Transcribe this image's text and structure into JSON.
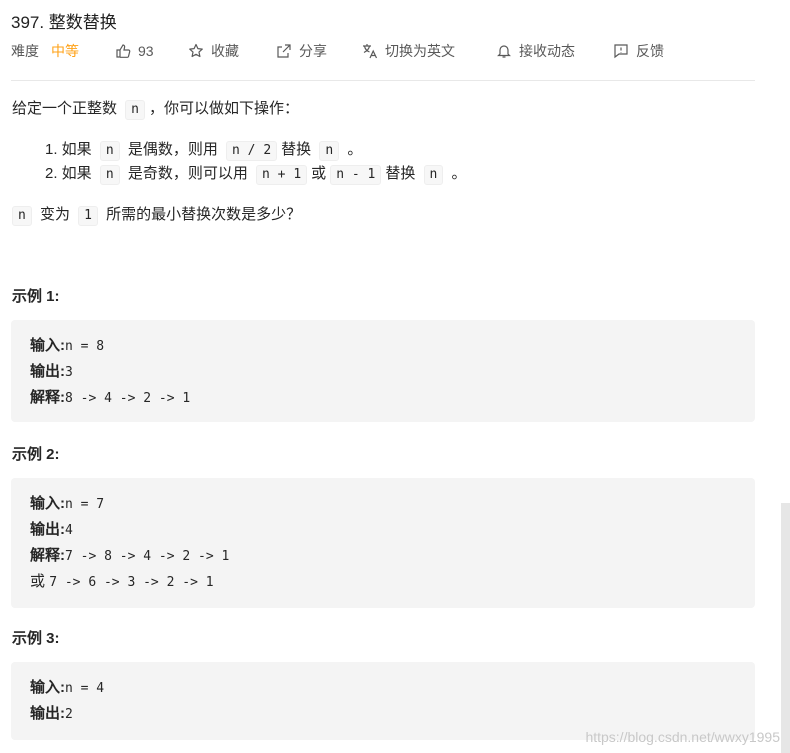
{
  "problem": {
    "title": "397. 整数替换",
    "difficulty_label": "难度",
    "difficulty_value": "中等",
    "likes": "93",
    "favorite_label": "收藏",
    "share_label": "分享",
    "switch_lang_label": "切换为英文",
    "notify_label": "接收动态",
    "feedback_label": "反馈"
  },
  "description": {
    "intro": "给定一个正整数 ",
    "intro_var": "n",
    "intro_rest": "，你可以做如下操作：",
    "rule1_prefix": "1. 如果 ",
    "rule1_var": "n",
    "rule1_mid": " 是偶数，则用 ",
    "rule1_expr": "n / 2",
    "rule1_mid2": "替换 ",
    "rule1_var2": "n",
    "rule1_end": " 。",
    "rule2_prefix": "2. 如果 ",
    "rule2_var": "n",
    "rule2_mid": " 是奇数，则可以用 ",
    "rule2_expr1": "n + 1",
    "rule2_or": "或",
    "rule2_expr2": "n - 1",
    "rule2_mid2": "替换 ",
    "rule2_var2": "n",
    "rule2_end": " 。",
    "question_var": "n",
    "question_mid": " 变为 ",
    "question_num": "1",
    "question_rest": " 所需的最小替换次数是多少？"
  },
  "examples": [
    {
      "title": "示例 1:",
      "lines": [
        {
          "label": "输入:",
          "text": "n = 8"
        },
        {
          "label": "输出:",
          "text": "3"
        },
        {
          "label": "解释:",
          "text": "8 -> 4 -> 2 -> 1"
        }
      ]
    },
    {
      "title": "示例 2:",
      "lines": [
        {
          "label": "输入:",
          "text": "n = 7"
        },
        {
          "label": "输出:",
          "text": "4"
        },
        {
          "label": "解释:",
          "text": "7 -> 8 -> 4 -> 2 -> 1"
        },
        {
          "label": "或",
          "text": "7 -> 6 -> 3 -> 2 -> 1"
        }
      ]
    },
    {
      "title": "示例 3:",
      "lines": [
        {
          "label": "输入:",
          "text": "n = 4"
        },
        {
          "label": "输出:",
          "text": "2"
        }
      ]
    }
  ],
  "watermark": "https://blog.csdn.net/wwxy1995",
  "colors": {
    "difficulty_medium": "#ffa116",
    "code_bg": "#f7f7f7",
    "example_bg": "#f4f4f4"
  }
}
